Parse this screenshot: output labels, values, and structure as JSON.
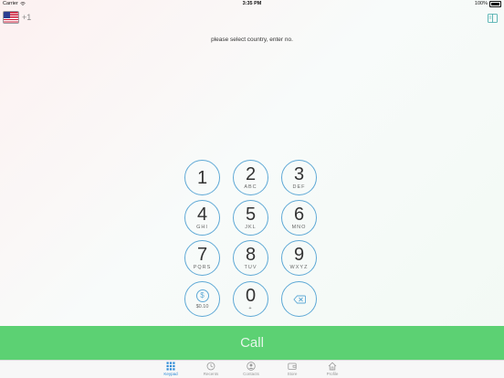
{
  "status_bar": {
    "carrier": "Carrier",
    "time": "3:35 PM",
    "battery": "100%"
  },
  "top_bar": {
    "country_flag": "us-flag-icon",
    "dial_code": "+1",
    "contacts_icon": "book-icon"
  },
  "prompt": "please select country, enter no.",
  "keypad": {
    "keys": [
      {
        "digit": "1",
        "letters": ""
      },
      {
        "digit": "2",
        "letters": "ABC"
      },
      {
        "digit": "3",
        "letters": "DEF"
      },
      {
        "digit": "4",
        "letters": "GHI"
      },
      {
        "digit": "5",
        "letters": "JKL"
      },
      {
        "digit": "6",
        "letters": "MNO"
      },
      {
        "digit": "7",
        "letters": "PQRS"
      },
      {
        "digit": "8",
        "letters": "TUV"
      },
      {
        "digit": "9",
        "letters": "WXYZ"
      },
      {
        "digit": "0",
        "letters": "+"
      }
    ],
    "balance_symbol": "$",
    "balance_value": "$0.10"
  },
  "call_label": "Call",
  "tabs": [
    {
      "label": "Keypad",
      "icon": "keypad-icon",
      "active": true
    },
    {
      "label": "Recents",
      "icon": "clock-icon",
      "active": false
    },
    {
      "label": "Contacts",
      "icon": "person-icon",
      "active": false
    },
    {
      "label": "Store",
      "icon": "wallet-icon",
      "active": false
    },
    {
      "label": "Profile",
      "icon": "home-icon",
      "active": false
    }
  ],
  "colors": {
    "accent": "#5fa9d6",
    "call_green": "#5cd173",
    "tab_active": "#2b8ad6"
  }
}
